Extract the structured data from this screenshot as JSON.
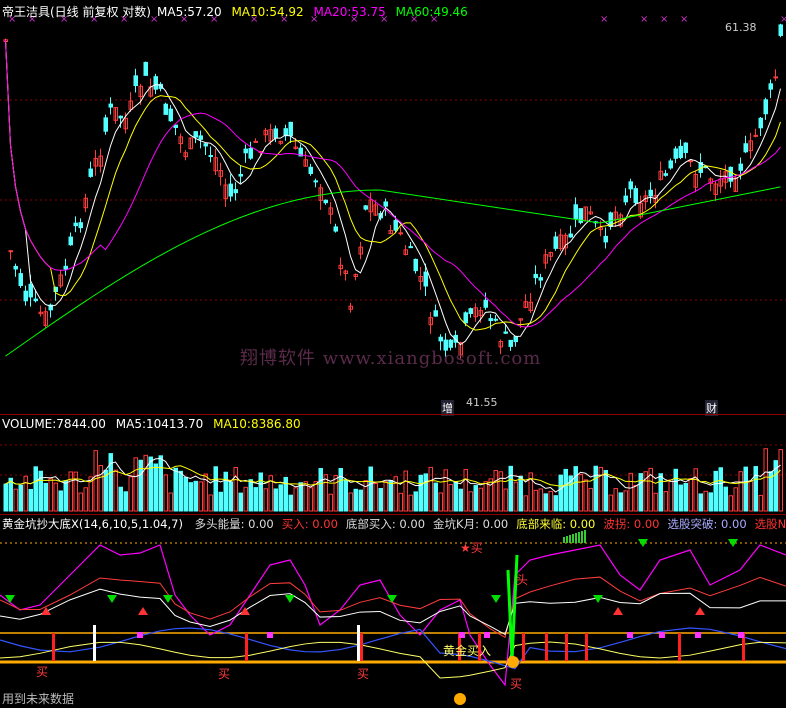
{
  "price_header": {
    "title": "帝王洁具(日线 前复权 对数)",
    "ma5_label": "MA5:",
    "ma5_value": "57.20",
    "ma10_label": "MA10:",
    "ma10_value": "54.92",
    "ma20_label": "MA20:",
    "ma20_value": "53.75",
    "ma60_label": "MA60:",
    "ma60_value": "49.46"
  },
  "price_panel": {
    "high_label": "61.38",
    "low_label": "41.55",
    "zeng_label": "增",
    "cai_label": "财",
    "watermark": "翔博软件 www.xiangbosoft.com"
  },
  "volume_header": {
    "volume_label": "VOLUME:",
    "volume_value": "7844.00",
    "ma5_label": "MA5:",
    "ma5_value": "10413.70",
    "ma10_label": "MA10:",
    "ma10_value": "8386.80"
  },
  "indicator_header": {
    "name": "黄金坑抄大底X(14,6,10,5,1.04,7)",
    "items": [
      {
        "label": "多头能量:",
        "value": "0.00",
        "color": "#dddddd"
      },
      {
        "label": "买入:",
        "value": "0.00",
        "color": "#ff3333"
      },
      {
        "label": "底部买入:",
        "value": "0.00",
        "color": "#dddddd"
      },
      {
        "label": "金坑K月:",
        "value": "0.00",
        "color": "#dddddd"
      },
      {
        "label": "底部来临:",
        "value": "0.00",
        "color": "#ffff33"
      },
      {
        "label": "波拐:",
        "value": "0.00",
        "color": "#ff3333"
      },
      {
        "label": "选股突破:",
        "value": "0.00",
        "color": "#aaaaff"
      },
      {
        "label": "选股NB:",
        "value": "",
        "color": "#ff3333"
      }
    ]
  },
  "indicator_labels": {
    "buy": "买",
    "star_buy": "★买",
    "gold_buy": "黄金买入",
    "top": "头"
  },
  "footer": "用到未来数据",
  "colors": {
    "up": "#ff3c3c",
    "down": "#54ffff",
    "ma5": "#ffffff",
    "ma10": "#ffff00",
    "ma20": "#ff00ff",
    "ma60": "#00ff00",
    "grid": "#8b0000",
    "orange": "#ffaa00"
  },
  "chart_data": {
    "type": "line",
    "title": "帝王洁具(日线 前复权 对数)",
    "series": [
      {
        "name": "MA5",
        "last": 57.2
      },
      {
        "name": "MA10",
        "last": 54.92
      },
      {
        "name": "MA20",
        "last": 53.75
      },
      {
        "name": "MA60",
        "last": 49.46
      }
    ],
    "annotations": {
      "high": 61.38,
      "low": 41.55
    },
    "volume": {
      "last": 7844.0,
      "ma5": 10413.7,
      "ma10": 8386.8
    }
  }
}
